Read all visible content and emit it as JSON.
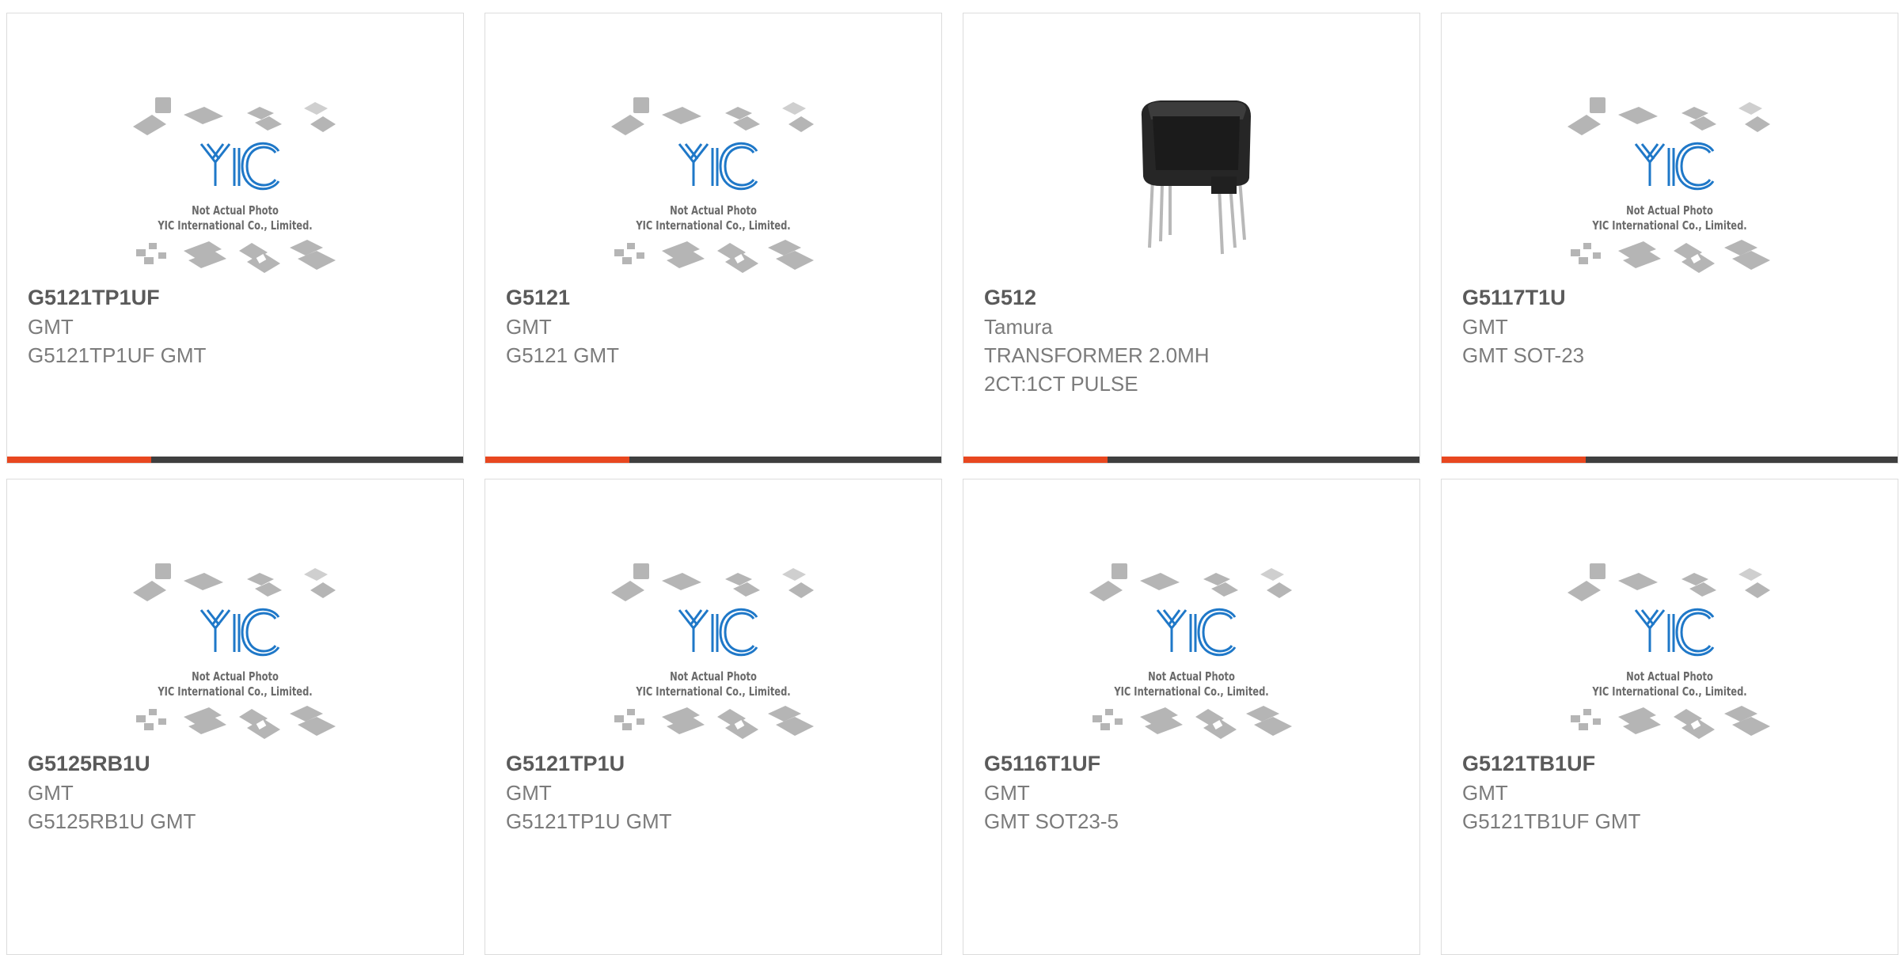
{
  "placeholder": {
    "logo_text": "YIC",
    "caption_line1": "Not Actual Photo",
    "caption_line2": "YIC International Co., Limited."
  },
  "colors": {
    "accent": "#e8471f",
    "bar": "#3f3f3f",
    "logo_blue": "#1f78c8",
    "text_dark": "#5a5a5a",
    "text_light": "#7b7b7b"
  },
  "products": [
    {
      "part_number": "G5121TP1UF",
      "manufacturer": "GMT",
      "description": "G5121TP1UF GMT",
      "image": "placeholder"
    },
    {
      "part_number": "G5121",
      "manufacturer": "GMT",
      "description": "G5121 GMT",
      "image": "placeholder"
    },
    {
      "part_number": "G512",
      "manufacturer": "Tamura",
      "description": "TRANSFORMER 2.0MH\n2CT:1CT PULSE",
      "image": "transformer-photo"
    },
    {
      "part_number": "G5117T1U",
      "manufacturer": "GMT",
      "description": "GMT SOT-23",
      "image": "placeholder"
    },
    {
      "part_number": "G5125RB1U",
      "manufacturer": "GMT",
      "description": "G5125RB1U GMT",
      "image": "placeholder"
    },
    {
      "part_number": "G5121TP1U",
      "manufacturer": "GMT",
      "description": "G5121TP1U GMT",
      "image": "placeholder"
    },
    {
      "part_number": "G5116T1UF",
      "manufacturer": "GMT",
      "description": "GMT SOT23-5",
      "image": "placeholder"
    },
    {
      "part_number": "G5121TB1UF",
      "manufacturer": "GMT",
      "description": "G5121TB1UF GMT",
      "image": "placeholder"
    }
  ]
}
